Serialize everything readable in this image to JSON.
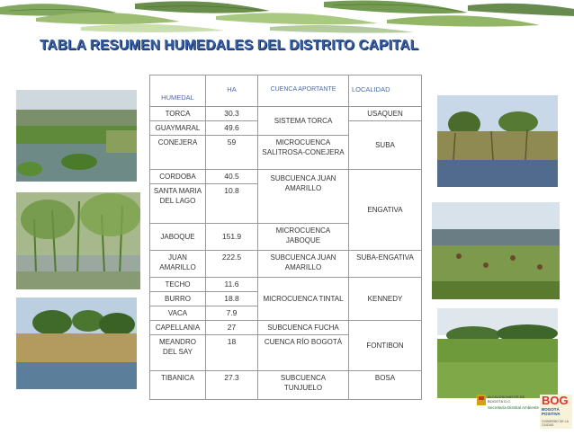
{
  "title": "TABLA RESUMEN HUMEDALES DEL DISTRITO CAPITAL",
  "headers": {
    "humedal": "HUMEDAL",
    "ha": "HA",
    "cuenca": "CUENCA APORTANTE",
    "localidad": "LOCALIDAD"
  },
  "rows": [
    {
      "humedal": "TORCA",
      "ha": "30.3"
    },
    {
      "humedal": "GUAYMARAL",
      "ha": "49.6"
    },
    {
      "humedal": "CONEJERA",
      "ha": "59"
    },
    {
      "humedal": "CORDOBA",
      "ha": "40.5"
    },
    {
      "humedal": "SANTA MARIA DEL LAGO",
      "ha": "10.8"
    },
    {
      "humedal": "JABOQUE",
      "ha": "151.9"
    },
    {
      "humedal": "JUAN AMARILLO",
      "ha": "222.5"
    },
    {
      "humedal": "TECHO",
      "ha": "11.6"
    },
    {
      "humedal": "BURRO",
      "ha": "18.8"
    },
    {
      "humedal": "VACA",
      "ha": "7.9"
    },
    {
      "humedal": "CAPELLANIA",
      "ha": "27"
    },
    {
      "humedal": "MEANDRO DEL SAY",
      "ha": "18"
    },
    {
      "humedal": "TIBANICA",
      "ha": "27.3"
    }
  ],
  "cuencas": {
    "torca": "SISTEMA TORCA",
    "salitrosa": "MICROCUENCA SALITROSA-CONEJERA",
    "juan_amarillo_1": "SUBCUENCA JUAN AMARILLO",
    "jaboque": "MICROCUENCA JABOQUE",
    "juan_amarillo_2": "SUBCUENCA JUAN AMARILLO",
    "tintal": "MICROCUENCA TINTAL",
    "fucha": "SUBCUENCA FUCHA",
    "bogota": "CUENCA RÍO BOGOTÁ",
    "tunjuelo": "SUBCUENCA TUNJUELO"
  },
  "localidades": {
    "usaquen": "USAQUEN",
    "suba": "SUBA",
    "engativa": "ENGATIVA",
    "suba_engativa": "SUBA-ENGATIVA",
    "kennedy": "KENNEDY",
    "fontibon": "FONTIBON",
    "bosa": "BOSA"
  },
  "footer": {
    "alcaldia": "ALCALDÍA MAYOR DE BOGOTÁ D.C.",
    "secretaria": "Secretaría Distrital Ambiente",
    "bog": "BOG",
    "bogota_positiva": "BOGOTÁ POSITIVA",
    "slogan": "GOBIERNO DE LA CIUDAD"
  },
  "colors": {
    "title": "#3a5fa0",
    "title_shadow": "#0b2b66",
    "header_text": "#4a6aa8",
    "border": "#9a9a9a",
    "leaf": "#5f8a3a"
  }
}
